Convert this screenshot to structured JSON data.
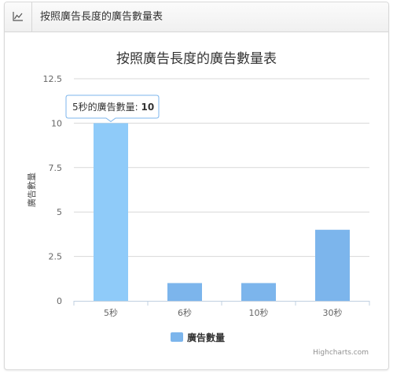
{
  "header": {
    "title": "按照廣告長度的廣告數量表",
    "icon": "line-chart-icon"
  },
  "colors": {
    "bar_light": "#8fcbf9",
    "bar": "#7cb5ec",
    "grid": "#d8d8d8",
    "axis": "#c0d0e0",
    "tooltip_border": "#7cb5ec"
  },
  "chart_data": {
    "type": "bar",
    "title": "按照廣告長度的廣告數量表",
    "categories": [
      "5秒",
      "6秒",
      "10秒",
      "30秒"
    ],
    "series": [
      {
        "name": "廣告數量",
        "values": [
          10,
          1,
          1,
          4
        ]
      }
    ],
    "ylabel": "廣告數量",
    "xlabel": "",
    "ylim": [
      0,
      12.5
    ],
    "yticks": [
      "0",
      "2.5",
      "5",
      "7.5",
      "10",
      "12.5"
    ],
    "grid": true,
    "legend": "bottom-center",
    "highlighted_index": 0,
    "tooltip": {
      "prefix": "5秒的廣告數量: ",
      "value": "10"
    },
    "credits": "Highcharts.com"
  }
}
